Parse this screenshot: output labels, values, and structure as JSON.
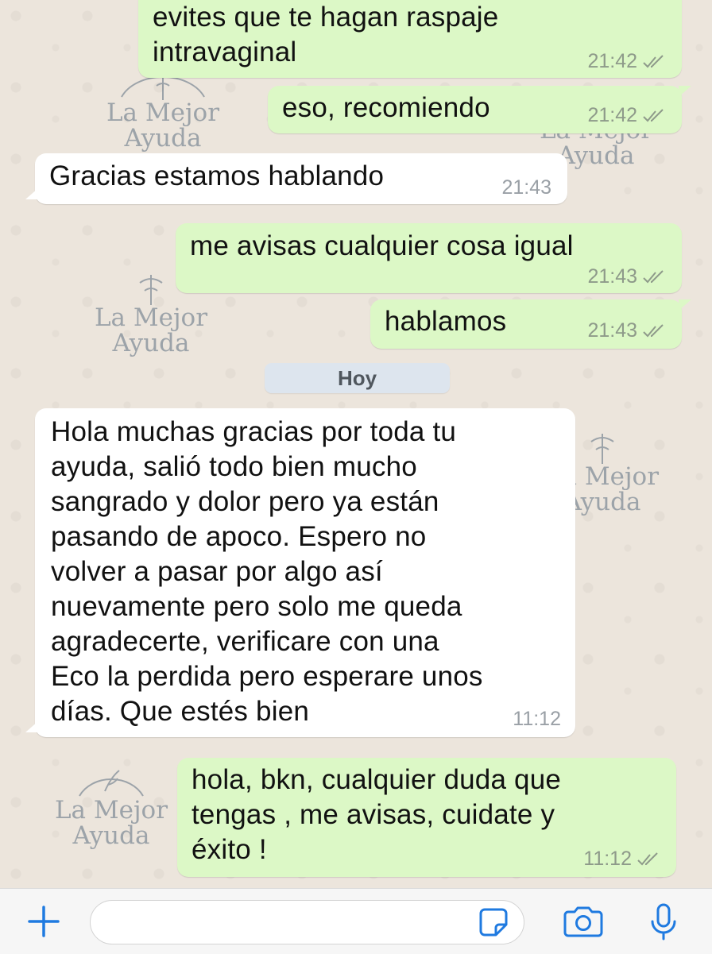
{
  "messages": [
    {
      "direction": "out",
      "text": "evites que te hagan raspaje\nintravaginal",
      "time": "21:42"
    },
    {
      "direction": "out",
      "text": "eso, recomiendo",
      "time": "21:42"
    },
    {
      "direction": "in",
      "text": "Gracias estamos hablando",
      "time": "21:43"
    },
    {
      "direction": "out",
      "text": "me avisas cualquier cosa igual",
      "time": "21:43"
    },
    {
      "direction": "out",
      "text": "hablamos",
      "time": "21:43"
    },
    {
      "direction": "in",
      "text": "Hola muchas gracias por toda tu\nayuda, salió todo bien mucho\nsangrado y dolor pero ya están\npasando de apoco. Espero no\nvolver a pasar por algo así\nnuevamente pero solo me queda\nagradecerte, verificare con una\nEco la perdida pero esperare unos\ndías. Que estés bien",
      "time": "11:12"
    },
    {
      "direction": "out",
      "text": "hola, bkn, cualquier duda que\ntengas , me avisas, cuidate y\néxito !",
      "time": "11:12"
    }
  ],
  "day_separator": "Hoy",
  "watermark": {
    "line1": "La Mejor",
    "line2": "Ayuda"
  },
  "input_bar": {
    "placeholder": "",
    "icons": [
      "plus-icon",
      "sticker-icon",
      "camera-icon",
      "microphone-icon"
    ]
  },
  "colors": {
    "outgoing": "#dcf8c6",
    "incoming": "#ffffff",
    "background": "#ece5dc",
    "accent": "#1f7ae0"
  }
}
